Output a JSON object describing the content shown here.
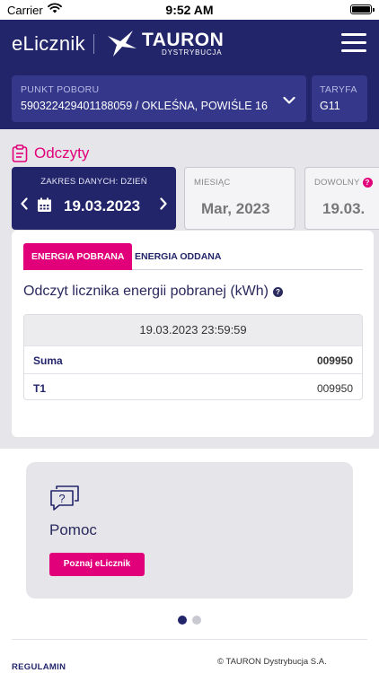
{
  "status_bar": {
    "carrier": "Carrier",
    "time": "9:52 AM"
  },
  "header": {
    "app_name": "eLicznik",
    "logo_text": "TAURON",
    "logo_subtext": "DYSTRYBUCJA"
  },
  "subheader": {
    "pp_label": "PUNKT POBORU",
    "pp_value": "590322429401188059 / OKLEŚNA, POWIŚLE 16",
    "tariff_label": "TARYFA",
    "tariff_value": "G11"
  },
  "readings": {
    "section_title": "Odczyty",
    "day_card": {
      "label": "ZAKRES DANYCH: DZIEŃ",
      "date": "19.03.2023"
    },
    "month_card": {
      "label": "MIESIĄC",
      "value": "Mar, 2023"
    },
    "any_card": {
      "label": "DOWOLNY",
      "value": "19.03."
    },
    "tabs": [
      {
        "label": "ENERGIA POBRANA",
        "active": true
      },
      {
        "label": "ENERGIA ODDANA",
        "active": false
      }
    ],
    "panel_title": "Odczyt licznika energii pobranej (kWh)",
    "table": {
      "header": "19.03.2023 23:59:59",
      "rows": [
        {
          "name": "Suma",
          "value": "009950"
        },
        {
          "name": "T1",
          "value": "009950"
        }
      ]
    }
  },
  "help": {
    "title": "Pomoc",
    "button_label": "Poznaj eLicznik"
  },
  "carousel": {
    "active_index": 0,
    "count": 2
  },
  "footer": {
    "regulamin": "REGULAMIN",
    "copyright": "© TAURON Dystrybucja S.A."
  },
  "colors": {
    "navy": "#23256b",
    "navy_light": "#34378a",
    "magenta": "#e2007a",
    "panel_bg": "#e6e6ea"
  }
}
